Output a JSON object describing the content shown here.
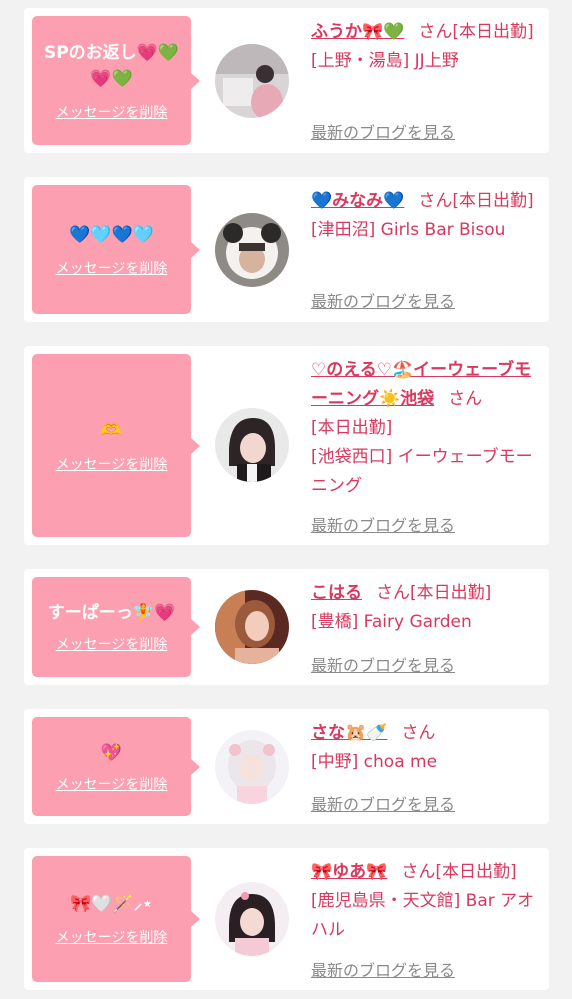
{
  "ui": {
    "delete_label": "メッセージを削除",
    "blog_label": "最新のブログを見る",
    "honorific": "さん",
    "colors": {
      "accent": "#d9385f",
      "bubble": "#fb9fb1",
      "background": "#f2f2f2",
      "card": "#ffffff",
      "muted": "#8a8a8a"
    }
  },
  "items": [
    {
      "message": "SPのお返し💗💚💗💚",
      "name": "ふうか🎀💚",
      "line1": "[本日出勤]",
      "line2": "[上野・湯島] JJ上野"
    },
    {
      "message": "💙🩵💙🩵",
      "name": "💙みなみ💙",
      "line1": "[本日出勤]",
      "line2": "[津田沼] Girls Bar Bisou"
    },
    {
      "message": "🫶",
      "name": "♡のえる♡🏖️イーウェーブモーニング☀️池袋",
      "line1": "[本日出勤]",
      "line2": "[池袋西口] イーウェーブモーニング"
    },
    {
      "message": "すーぱーっ🧚💗",
      "name": "こはる",
      "line1": "[本日出勤]",
      "line2": "[豊橋] Fairy Garden"
    },
    {
      "message": "💖",
      "name": "さな🐹🍼",
      "line1": "",
      "line2": "[中野] choa me"
    },
    {
      "message": "🎀🤍🪄⸝⋆",
      "name": "🎀ゆあ🎀",
      "line1": "[本日出勤]",
      "line2": "[鹿児島県・天文館] Bar アオハル"
    }
  ]
}
